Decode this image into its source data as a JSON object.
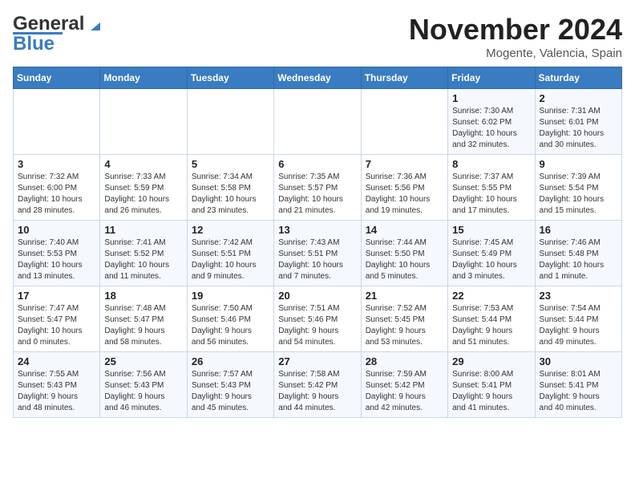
{
  "logo": {
    "line1": "General",
    "line2": "Blue"
  },
  "title": "November 2024",
  "subtitle": "Mogente, Valencia, Spain",
  "days_of_week": [
    "Sunday",
    "Monday",
    "Tuesday",
    "Wednesday",
    "Thursday",
    "Friday",
    "Saturday"
  ],
  "weeks": [
    [
      {
        "day": "",
        "info": ""
      },
      {
        "day": "",
        "info": ""
      },
      {
        "day": "",
        "info": ""
      },
      {
        "day": "",
        "info": ""
      },
      {
        "day": "",
        "info": ""
      },
      {
        "day": "1",
        "info": "Sunrise: 7:30 AM\nSunset: 6:02 PM\nDaylight: 10 hours\nand 32 minutes."
      },
      {
        "day": "2",
        "info": "Sunrise: 7:31 AM\nSunset: 6:01 PM\nDaylight: 10 hours\nand 30 minutes."
      }
    ],
    [
      {
        "day": "3",
        "info": "Sunrise: 7:32 AM\nSunset: 6:00 PM\nDaylight: 10 hours\nand 28 minutes."
      },
      {
        "day": "4",
        "info": "Sunrise: 7:33 AM\nSunset: 5:59 PM\nDaylight: 10 hours\nand 26 minutes."
      },
      {
        "day": "5",
        "info": "Sunrise: 7:34 AM\nSunset: 5:58 PM\nDaylight: 10 hours\nand 23 minutes."
      },
      {
        "day": "6",
        "info": "Sunrise: 7:35 AM\nSunset: 5:57 PM\nDaylight: 10 hours\nand 21 minutes."
      },
      {
        "day": "7",
        "info": "Sunrise: 7:36 AM\nSunset: 5:56 PM\nDaylight: 10 hours\nand 19 minutes."
      },
      {
        "day": "8",
        "info": "Sunrise: 7:37 AM\nSunset: 5:55 PM\nDaylight: 10 hours\nand 17 minutes."
      },
      {
        "day": "9",
        "info": "Sunrise: 7:39 AM\nSunset: 5:54 PM\nDaylight: 10 hours\nand 15 minutes."
      }
    ],
    [
      {
        "day": "10",
        "info": "Sunrise: 7:40 AM\nSunset: 5:53 PM\nDaylight: 10 hours\nand 13 minutes."
      },
      {
        "day": "11",
        "info": "Sunrise: 7:41 AM\nSunset: 5:52 PM\nDaylight: 10 hours\nand 11 minutes."
      },
      {
        "day": "12",
        "info": "Sunrise: 7:42 AM\nSunset: 5:51 PM\nDaylight: 10 hours\nand 9 minutes."
      },
      {
        "day": "13",
        "info": "Sunrise: 7:43 AM\nSunset: 5:51 PM\nDaylight: 10 hours\nand 7 minutes."
      },
      {
        "day": "14",
        "info": "Sunrise: 7:44 AM\nSunset: 5:50 PM\nDaylight: 10 hours\nand 5 minutes."
      },
      {
        "day": "15",
        "info": "Sunrise: 7:45 AM\nSunset: 5:49 PM\nDaylight: 10 hours\nand 3 minutes."
      },
      {
        "day": "16",
        "info": "Sunrise: 7:46 AM\nSunset: 5:48 PM\nDaylight: 10 hours\nand 1 minute."
      }
    ],
    [
      {
        "day": "17",
        "info": "Sunrise: 7:47 AM\nSunset: 5:47 PM\nDaylight: 10 hours\nand 0 minutes."
      },
      {
        "day": "18",
        "info": "Sunrise: 7:48 AM\nSunset: 5:47 PM\nDaylight: 9 hours\nand 58 minutes."
      },
      {
        "day": "19",
        "info": "Sunrise: 7:50 AM\nSunset: 5:46 PM\nDaylight: 9 hours\nand 56 minutes."
      },
      {
        "day": "20",
        "info": "Sunrise: 7:51 AM\nSunset: 5:46 PM\nDaylight: 9 hours\nand 54 minutes."
      },
      {
        "day": "21",
        "info": "Sunrise: 7:52 AM\nSunset: 5:45 PM\nDaylight: 9 hours\nand 53 minutes."
      },
      {
        "day": "22",
        "info": "Sunrise: 7:53 AM\nSunset: 5:44 PM\nDaylight: 9 hours\nand 51 minutes."
      },
      {
        "day": "23",
        "info": "Sunrise: 7:54 AM\nSunset: 5:44 PM\nDaylight: 9 hours\nand 49 minutes."
      }
    ],
    [
      {
        "day": "24",
        "info": "Sunrise: 7:55 AM\nSunset: 5:43 PM\nDaylight: 9 hours\nand 48 minutes."
      },
      {
        "day": "25",
        "info": "Sunrise: 7:56 AM\nSunset: 5:43 PM\nDaylight: 9 hours\nand 46 minutes."
      },
      {
        "day": "26",
        "info": "Sunrise: 7:57 AM\nSunset: 5:43 PM\nDaylight: 9 hours\nand 45 minutes."
      },
      {
        "day": "27",
        "info": "Sunrise: 7:58 AM\nSunset: 5:42 PM\nDaylight: 9 hours\nand 44 minutes."
      },
      {
        "day": "28",
        "info": "Sunrise: 7:59 AM\nSunset: 5:42 PM\nDaylight: 9 hours\nand 42 minutes."
      },
      {
        "day": "29",
        "info": "Sunrise: 8:00 AM\nSunset: 5:41 PM\nDaylight: 9 hours\nand 41 minutes."
      },
      {
        "day": "30",
        "info": "Sunrise: 8:01 AM\nSunset: 5:41 PM\nDaylight: 9 hours\nand 40 minutes."
      }
    ]
  ]
}
